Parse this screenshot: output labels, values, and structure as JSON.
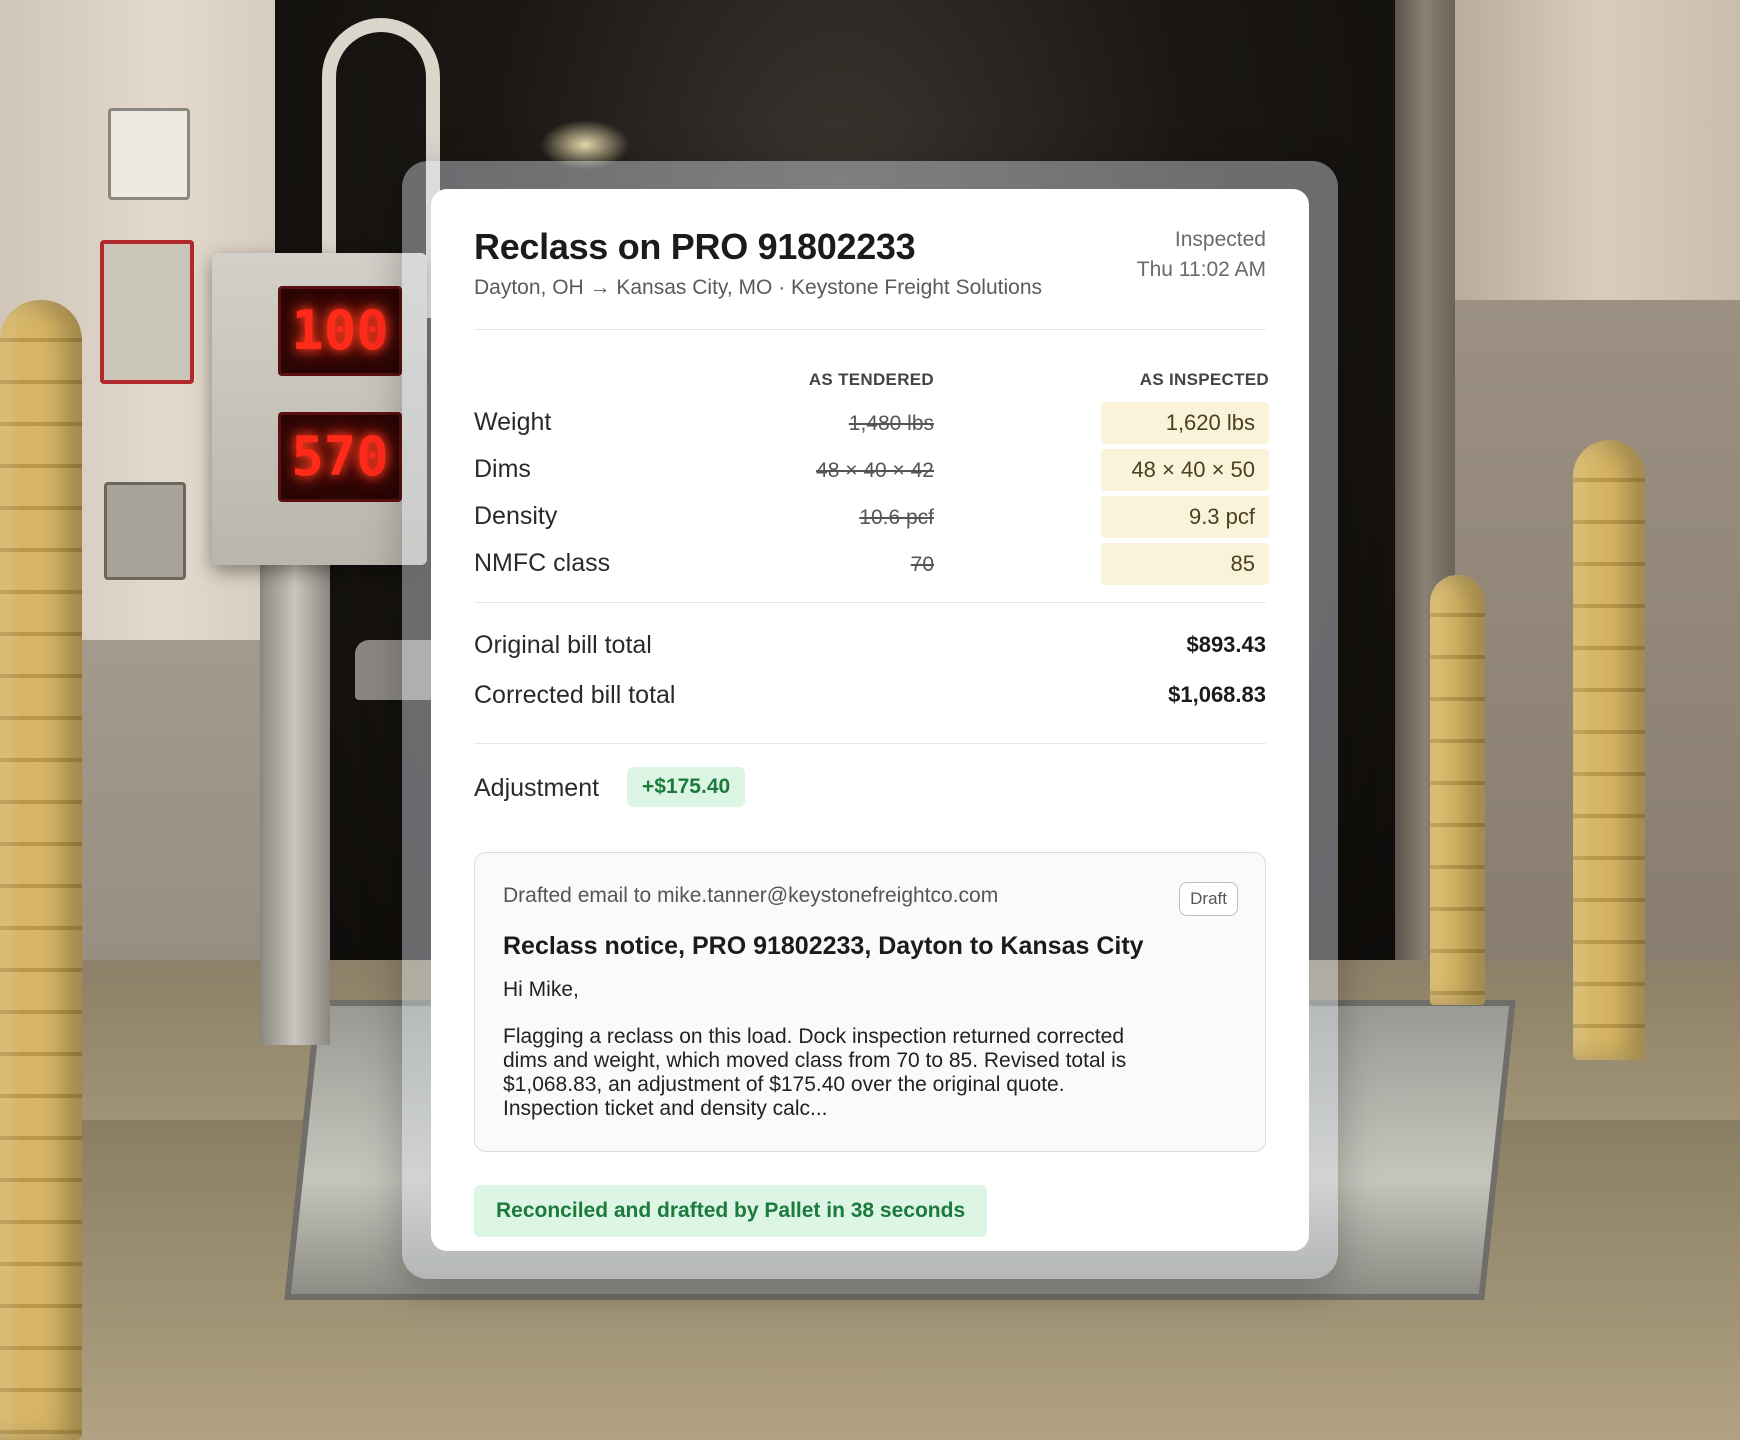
{
  "card": {
    "title": "Reclass on PRO 91802233",
    "route": "Dayton, OH → Kansas City, MO · Keystone Freight Solutions",
    "status": "Inspected",
    "timestamp": "Thu 11:02 AM"
  },
  "comparison": {
    "col_tendered": "AS TENDERED",
    "col_inspected": "AS INSPECTED",
    "rows": [
      {
        "label": "Weight",
        "tendered": "1,480 lbs",
        "inspected": "1,620 lbs"
      },
      {
        "label": "Dims",
        "tendered": "48 × 40 × 42",
        "inspected": "48 × 40 × 50"
      },
      {
        "label": "Density",
        "tendered": "10.6 pcf",
        "inspected": "9.3 pcf"
      },
      {
        "label": "NMFC class",
        "tendered": "70",
        "inspected": "85"
      }
    ]
  },
  "totals": {
    "original_label": "Original bill total",
    "original_value": "$893.43",
    "corrected_label": "Corrected bill total",
    "corrected_value": "$1,068.83"
  },
  "adjustment": {
    "label": "Adjustment",
    "value": "+$175.40"
  },
  "email": {
    "to_line": "Drafted email to mike.tanner@keystonefreightco.com",
    "badge": "Draft",
    "subject": "Reclass notice, PRO 91802233, Dayton to Kansas City",
    "greeting": "Hi Mike,",
    "body": "Flagging a reclass on this load. Dock inspection returned corrected dims and weight, which moved class from 70 to 85. Revised total is $1,068.83, an adjustment of $175.40 over the original quote. Inspection ticket and density calc..."
  },
  "footer": {
    "note": "Reconciled and drafted by Pallet in 38 seconds"
  },
  "scene": {
    "scale_display_top": "100",
    "scale_display_bottom": "570"
  },
  "colors": {
    "accent_green": "#1b7a3c",
    "green_bg": "#dcf5e5",
    "highlight_bg": "#fbf3d9"
  }
}
